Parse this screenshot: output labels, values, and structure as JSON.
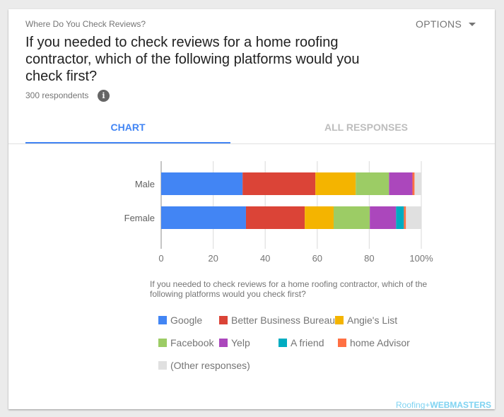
{
  "card": {
    "eyebrow": "Where Do You Check Reviews?",
    "options_label": "OPTIONS",
    "title": "If you needed to check reviews for a home roofing contractor, which of the following platforms would you check first?",
    "respondents": "300 respondents",
    "info_icon": "i"
  },
  "tabs": [
    {
      "label": "CHART",
      "active": true
    },
    {
      "label": "ALL RESPONSES",
      "active": false
    }
  ],
  "watermark": {
    "part1": "Roofing",
    "sep": "+",
    "part2": "WEBMASTERS"
  },
  "chart_data": {
    "type": "bar",
    "orientation": "horizontal",
    "stacked": "percent",
    "categories": [
      "Male",
      "Female"
    ],
    "series": [
      {
        "name": "Google",
        "color": "#4285f4",
        "values": [
          31.3,
          32.6
        ]
      },
      {
        "name": "Better Business Bureau",
        "color": "#db4437",
        "values": [
          28.0,
          22.6
        ]
      },
      {
        "name": "Angie's List",
        "color": "#f4b400",
        "values": [
          15.5,
          11.1
        ]
      },
      {
        "name": "Facebook",
        "color": "#9ccc65",
        "values": [
          12.8,
          13.9
        ]
      },
      {
        "name": "Yelp",
        "color": "#ab47bc",
        "values": [
          9.0,
          10.1
        ]
      },
      {
        "name": "A friend",
        "color": "#00acc1",
        "values": [
          0,
          3.0
        ]
      },
      {
        "name": "home Advisor",
        "color": "#ff7043",
        "values": [
          0.8,
          0.8
        ]
      },
      {
        "name": "(Other responses)",
        "color": "#e0e0e0",
        "values": [
          2.6,
          6.0
        ]
      }
    ],
    "xticks": [
      "0",
      "20",
      "40",
      "60",
      "80",
      "100%"
    ],
    "xlim": [
      0,
      100
    ],
    "grid": true,
    "legend_title": "If you needed to check reviews for a home roofing contractor, which of the following platforms would you check first?",
    "legend_position": "bottom"
  }
}
